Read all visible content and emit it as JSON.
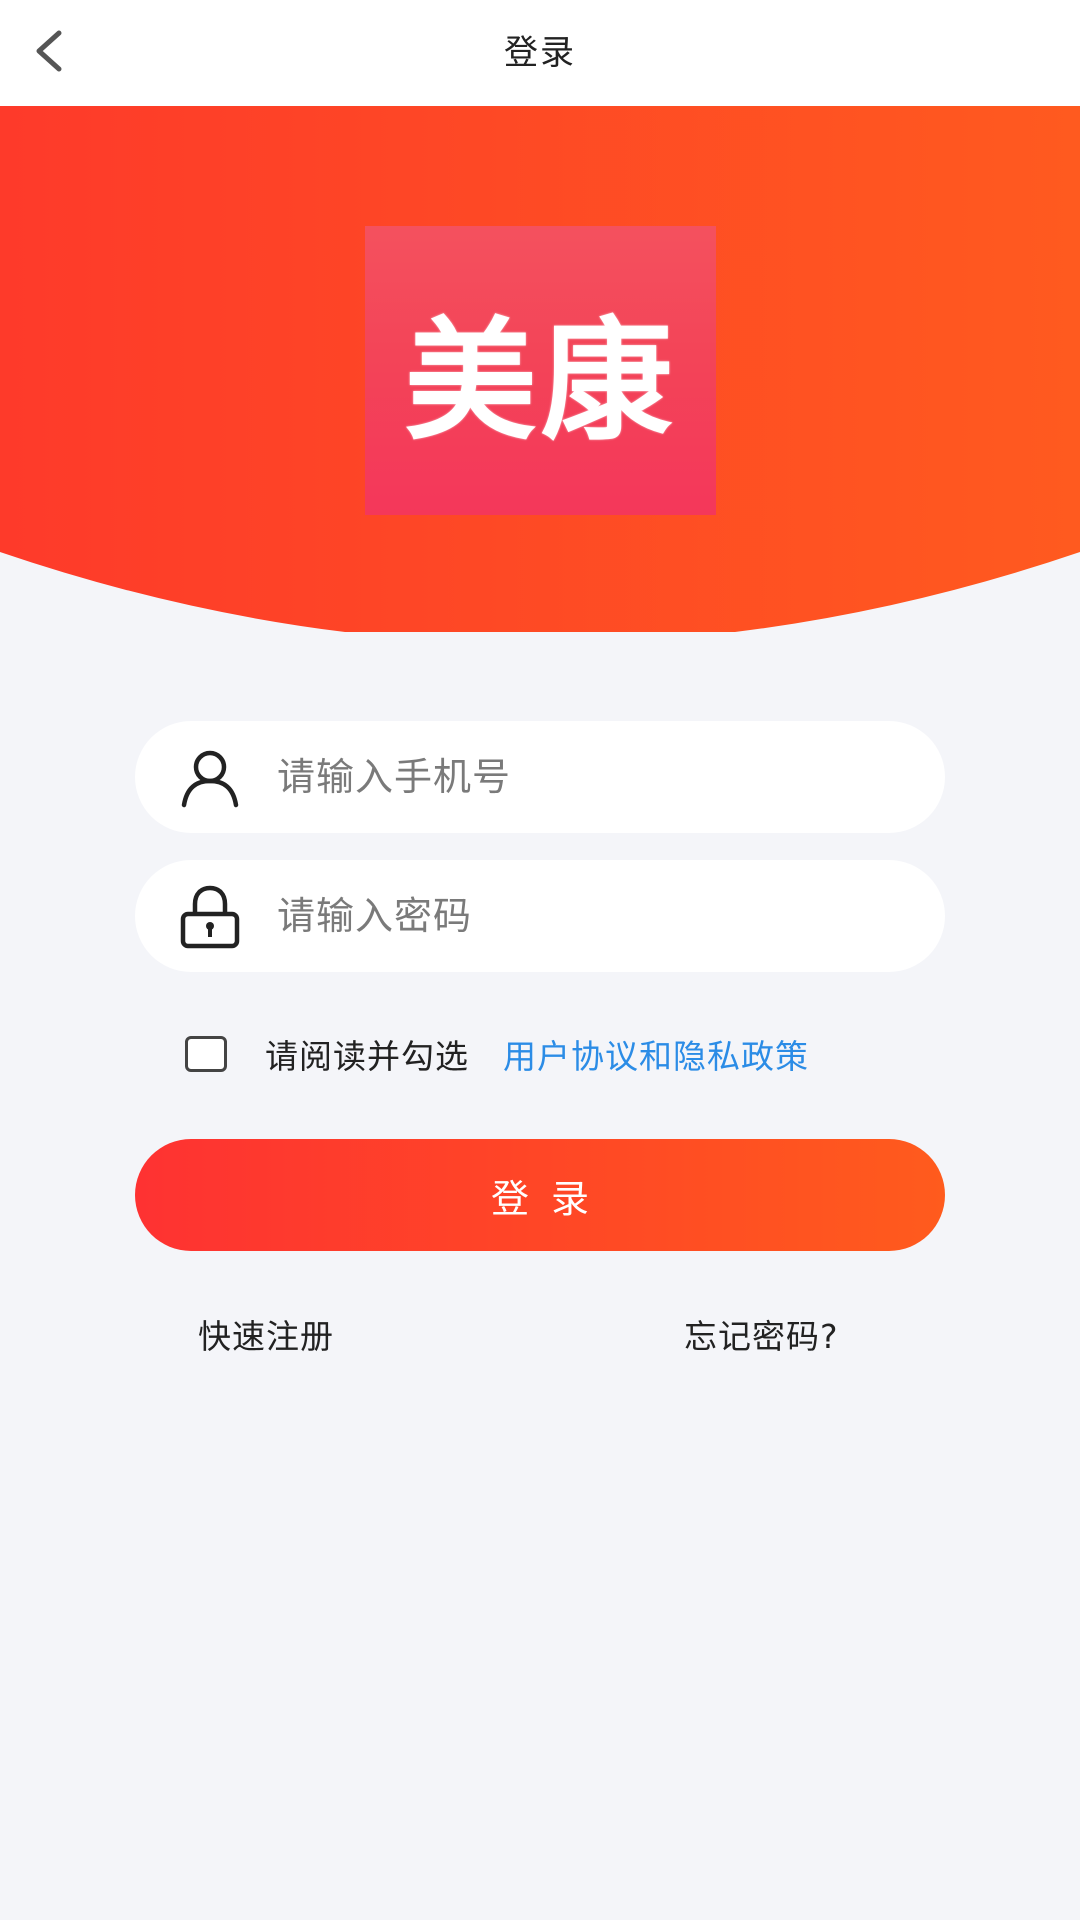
{
  "navbar": {
    "title": "登录",
    "back_icon": "chevron-left-icon"
  },
  "hero": {
    "logo_text": "美康",
    "colors": {
      "left": "#fe3a2a",
      "right": "#ff5a1f",
      "logo_bg": "#f4415a"
    }
  },
  "form": {
    "phone": {
      "placeholder": "请输入手机号",
      "icon": "user-icon"
    },
    "password": {
      "placeholder": "请输入密码",
      "icon": "lock-icon"
    }
  },
  "agreement": {
    "text": "请阅读并勾选",
    "link": "用户协议和隐私政策",
    "link_color": "#2b8ce6",
    "checked": false
  },
  "login_button": {
    "label": "登录"
  },
  "links": {
    "register": "快速注册",
    "forgot": "忘记密码?"
  }
}
